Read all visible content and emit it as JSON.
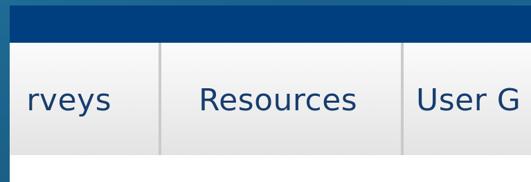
{
  "nav": {
    "tabs": [
      {
        "label": "rveys"
      },
      {
        "label": "Resources"
      },
      {
        "label": "User G"
      }
    ]
  }
}
